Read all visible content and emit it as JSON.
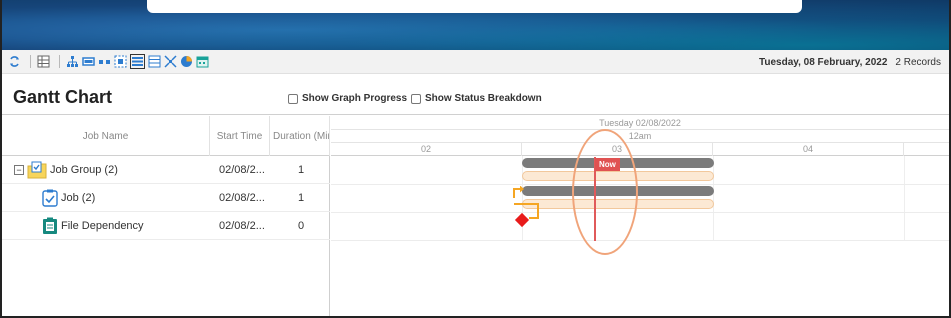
{
  "toolbar": {
    "date": "Tuesday, 08 February, 2022",
    "records": "2 Records",
    "icons": [
      "refresh-icon",
      "table-icon",
      "hierarchy-icon",
      "bar-layout-icon",
      "dots-icon",
      "fit-icon",
      "list-view-icon",
      "rows-icon",
      "expand-icon",
      "pie-chart-icon",
      "calendar-icon"
    ],
    "accent": "#1f7fd1"
  },
  "page": {
    "title": "Gantt Chart",
    "show_graph_progress": "Show Graph Progress",
    "show_status_breakdown": "Show Status Breakdown"
  },
  "grid": {
    "columns": [
      "Job Name",
      "Start Time",
      "Duration (Mir"
    ],
    "rows": [
      {
        "name": "Job Group (2)",
        "start": "02/08/2...",
        "duration": "1",
        "icon": "job-group-icon",
        "expander": "−"
      },
      {
        "name": "Job (2)",
        "start": "02/08/2...",
        "duration": "1",
        "icon": "job-check-icon"
      },
      {
        "name": "File Dependency",
        "start": "02/08/2...",
        "duration": "0",
        "icon": "file-dependency-icon"
      }
    ]
  },
  "timeline": {
    "day_label": "Tuesday 02/08/2022",
    "period_label": "12am",
    "hours": [
      "02",
      "03",
      "04"
    ],
    "now_label": "Now",
    "colors": {
      "bar": "#7b7b7b",
      "progress": "#fce9d4",
      "now": "#e05252",
      "dependency": "#e81b1b",
      "link": "#f5a623"
    }
  }
}
